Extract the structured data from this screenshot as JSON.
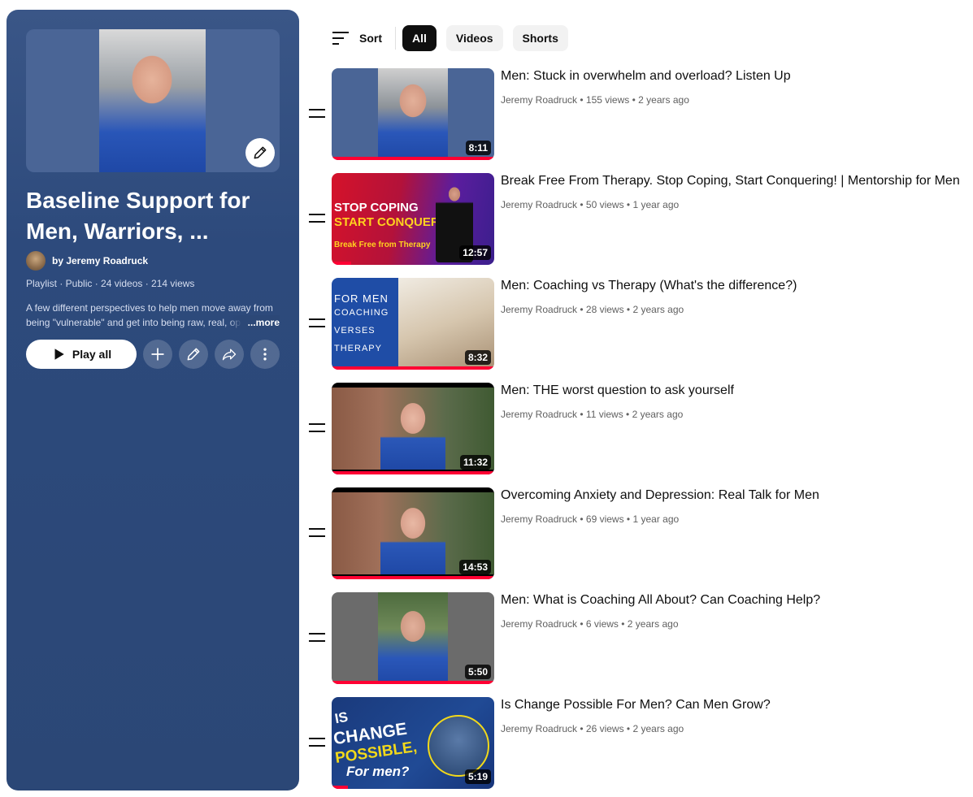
{
  "playlist": {
    "title": "Baseline Support for Men, Warriors, ...",
    "owner": "by Jeremy Roadruck",
    "meta": "Playlist · Public · 24 videos · 214 views",
    "description": "A few different perspectives to help men move away from being \"vulnerable\" and get into being raw, real, open",
    "more_label": "...more",
    "play_all_label": "Play all"
  },
  "filters": {
    "sort_label": "Sort",
    "chips": [
      "All",
      "Videos",
      "Shorts"
    ],
    "active": "All"
  },
  "videos": [
    {
      "title": "Men: Stuck in overwhelm and overload? Listen Up",
      "channel": "Jeremy Roadruck",
      "views": "155 views",
      "age": "2 years ago",
      "duration": "8:11",
      "progress": 1.0
    },
    {
      "title": "Break Free From Therapy. Stop Coping, Start Conquering! | Mentorship for Men",
      "channel": "Jeremy Roadruck",
      "views": "50 views",
      "age": "1 year ago",
      "duration": "12:57",
      "progress": 0.12,
      "thumb_text": [
        "STOP COPING",
        "START CONQUERING",
        "Break Free from Therapy"
      ]
    },
    {
      "title": "Men: Coaching vs Therapy (What's the difference?)",
      "channel": "Jeremy Roadruck",
      "views": "28 views",
      "age": "2 years ago",
      "duration": "8:32",
      "progress": 1.0,
      "thumb_text": [
        "FOR MEN",
        "COACHING",
        "VERSES",
        "THERAPY"
      ]
    },
    {
      "title": "Men: THE worst question to ask yourself",
      "channel": "Jeremy Roadruck",
      "views": "11 views",
      "age": "2 years ago",
      "duration": "11:32",
      "progress": 1.0
    },
    {
      "title": "Overcoming Anxiety and Depression: Real Talk for Men",
      "channel": "Jeremy Roadruck",
      "views": "69 views",
      "age": "1 year ago",
      "duration": "14:53",
      "progress": 1.0
    },
    {
      "title": "Men: What is Coaching All About? Can Coaching Help?",
      "channel": "Jeremy Roadruck",
      "views": "6 views",
      "age": "2 years ago",
      "duration": "5:50",
      "progress": 1.0
    },
    {
      "title": "Is Change Possible For Men? Can Men Grow?",
      "channel": "Jeremy Roadruck",
      "views": "26 views",
      "age": "2 years ago",
      "duration": "5:19",
      "progress": 0.1,
      "thumb_text": [
        "IS",
        "CHANGE",
        "POSSIBLE,",
        "For men?"
      ]
    }
  ],
  "colors": {
    "accent_red": "#ff0033",
    "panel_blue": "#2b4776"
  }
}
